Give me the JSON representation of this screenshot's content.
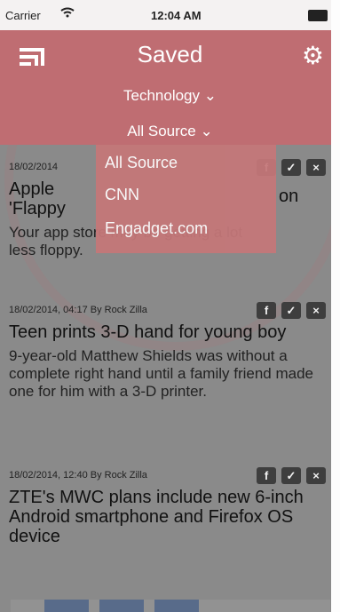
{
  "status_bar": {
    "carrier": "Carrier",
    "time": "12:04 AM"
  },
  "nav": {
    "title": "Saved",
    "category": "Technology",
    "source": "All Source"
  },
  "source_menu": {
    "items": [
      "All Source",
      "CNN",
      "Engadget.com"
    ]
  },
  "articles": [
    {
      "meta": "18/02/2014",
      "headline_partial": "Apple",
      "headline_right": "on",
      "headline_line2": "'Flappy",
      "summary_line1": "Your app store may be getting a lot",
      "summary_line2": "less floppy."
    },
    {
      "meta": "18/02/2014, 04:17 By Rock Zilla",
      "headline": "Teen prints 3-D hand for young boy",
      "summary": "9-year-old Matthew Shields was without a complete right hand until a family friend made one for him with a 3-D printer."
    },
    {
      "meta": "18/02/2014, 12:40 By Rock Zilla",
      "headline": "ZTE's MWC plans include new 6-inch Android smartphone and Firefox OS device"
    }
  ],
  "icons": {
    "menu": "menu-icon",
    "settings": "gear-icon",
    "facebook": "f",
    "twitter": "twitter-icon",
    "close": "x"
  }
}
